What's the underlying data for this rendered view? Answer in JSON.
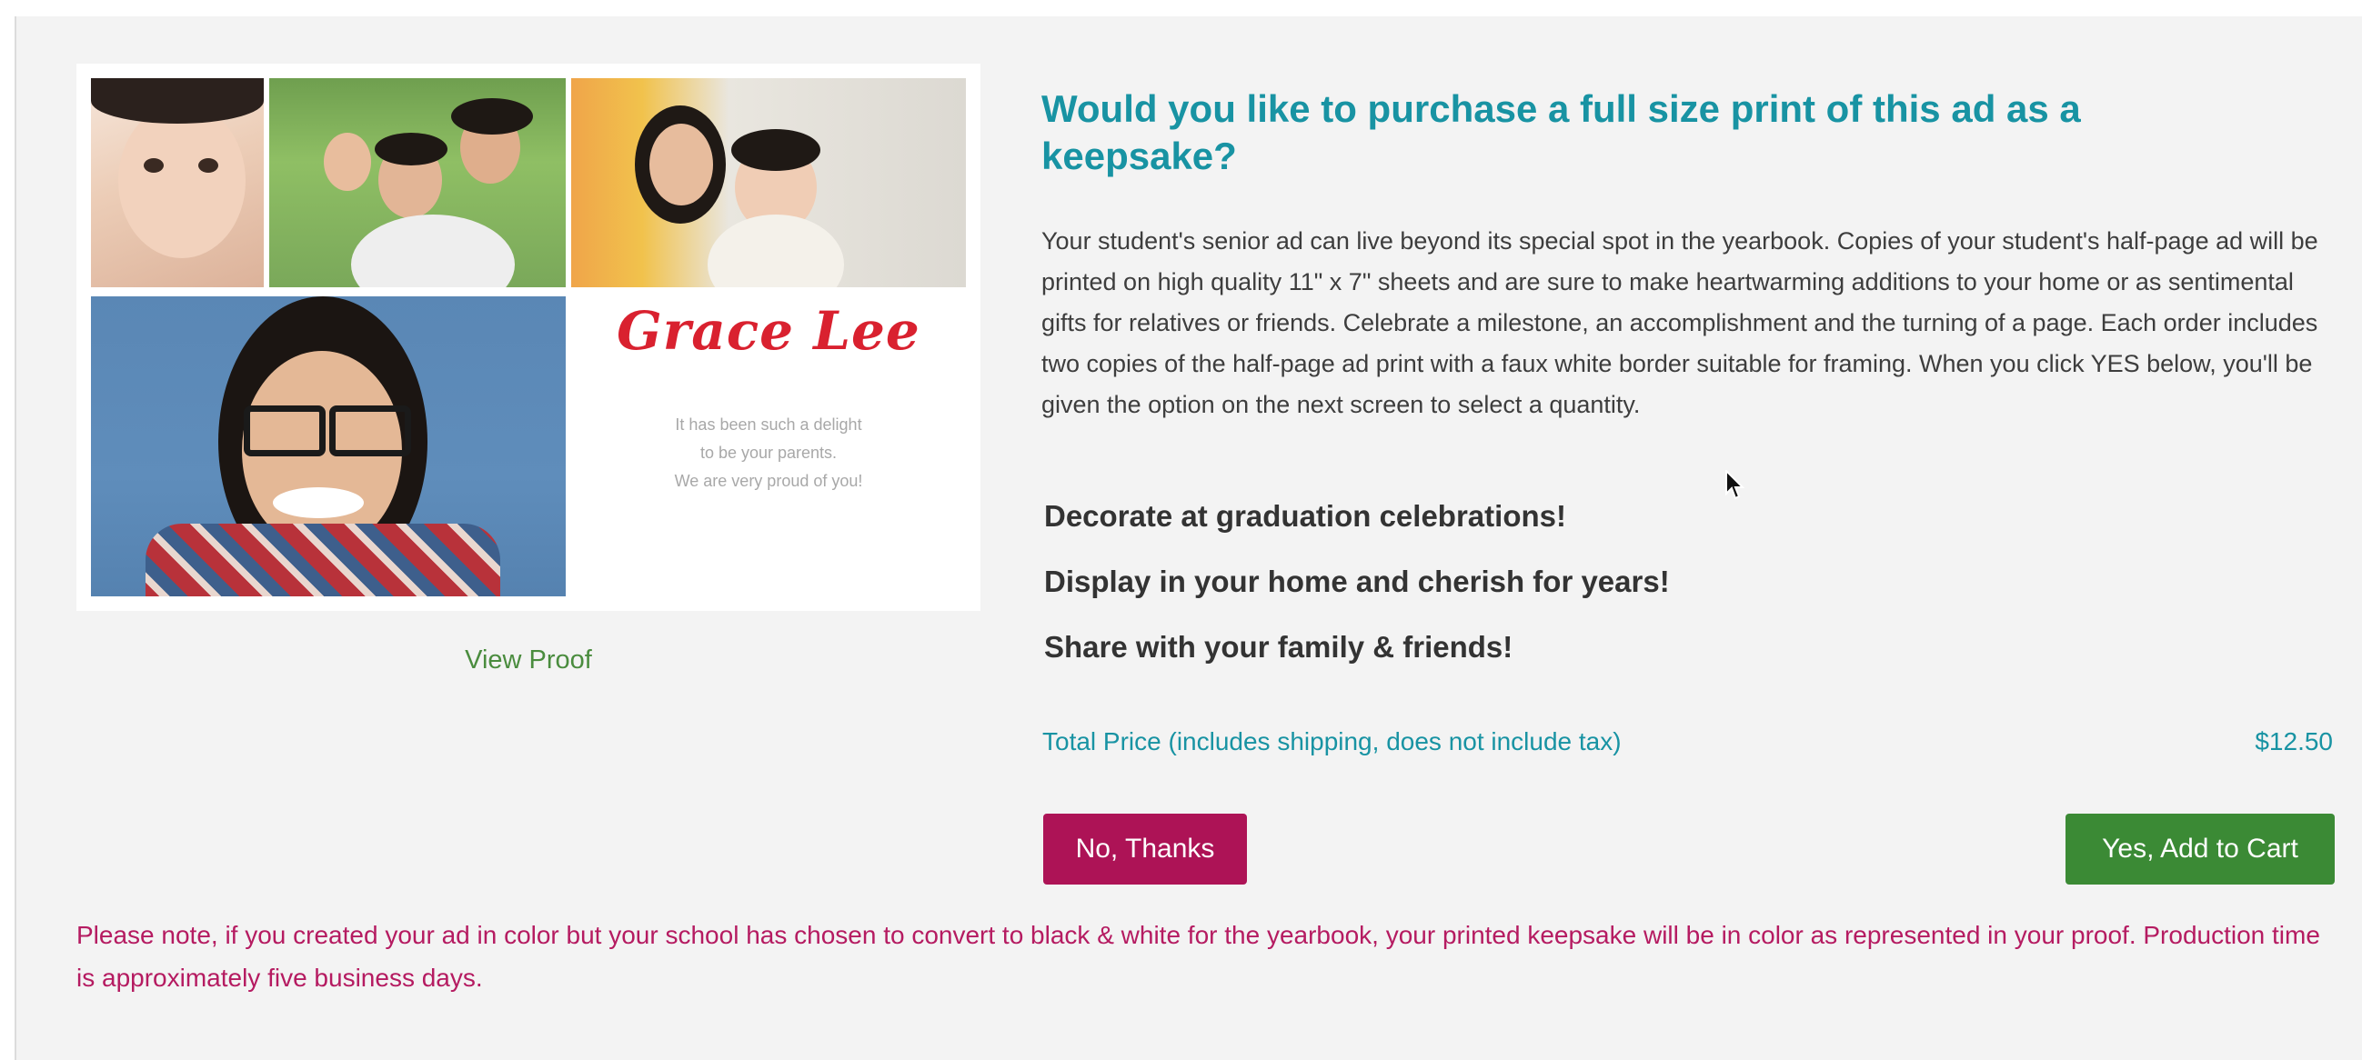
{
  "proof": {
    "name": "Grace Lee",
    "message_lines": [
      "It has been such a delight",
      "to be your parents.",
      "We are very proud of you!"
    ],
    "view_proof_label": "View Proof"
  },
  "offer": {
    "title": "Would you like to purchase a full size print of this ad as a keepsake?",
    "description": "Your student's senior ad can live beyond its special spot in the yearbook. Copies of your student's half-page ad will be printed on high quality 11\" x 7\" sheets and are sure to make heartwarming additions to your home or as sentimental gifts for relatives or friends. Celebrate a milestone, an accomplishment and the turning of a page. Each order includes two copies of the half-page ad print with a faux white border suitable for framing. When you click YES below, you'll be given the option on the next screen to select a quantity.",
    "features": [
      "Decorate at graduation celebrations!",
      "Display in your home and cherish for years!",
      "Share with your family & friends!"
    ],
    "price_label": "Total Price (includes shipping, does not include tax)",
    "price_value": "$12.50",
    "no_label": "No, Thanks",
    "yes_label": "Yes, Add to Cart"
  },
  "note": "Please note, if you created your ad in color but your school has chosen to convert to black & white for the yearbook, your printed keepsake will be in color as represented in your proof. Production time is approximately five business days.",
  "colors": {
    "teal": "#1893a3",
    "magenta": "#ad1356",
    "green": "#3b8a35",
    "script_red": "#d9212f"
  }
}
